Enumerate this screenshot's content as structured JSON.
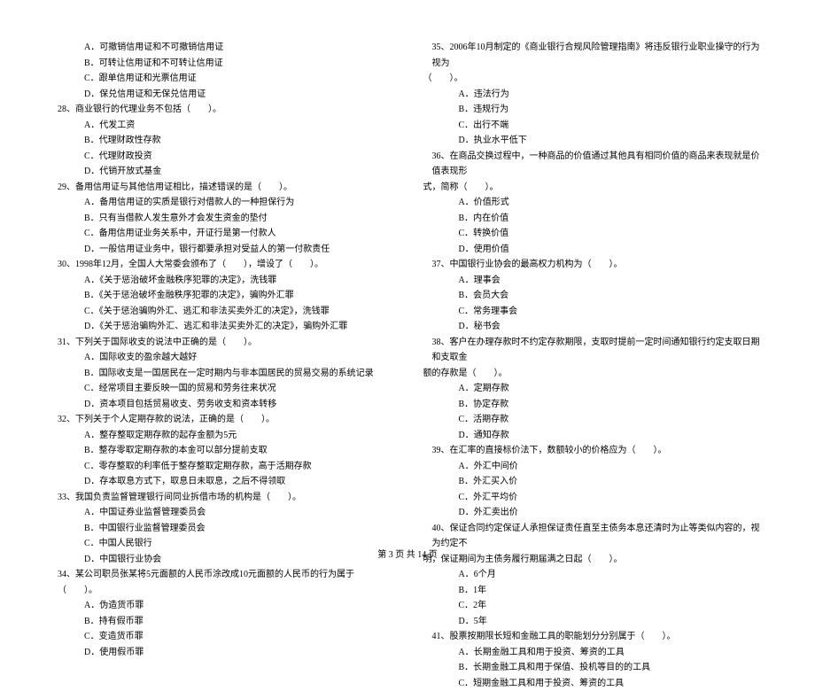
{
  "left": {
    "q27opts": [
      "A．可撤销信用证和不可撤销信用证",
      "B．可转让信用证和不可转让信用证",
      "C．跟单信用证和光票信用证",
      "D．保兑信用证和无保兑信用证"
    ],
    "q28": "28、商业银行的代理业务不包括（　　）。",
    "q28opts": [
      "A．代发工资",
      "B．代理财政性存款",
      "C．代理财政投资",
      "D．代销开放式基金"
    ],
    "q29": "29、备用信用证与其他信用证相比，描述错误的是（　　）。",
    "q29opts": [
      "A．备用信用证的实质是银行对借款人的一种担保行为",
      "B．只有当借款人发生意外才会发生资金的垫付",
      "C．备用信用证业务关系中，开证行是第一付款人",
      "D．一般信用证业务中，银行都要承担对受益人的第一付款责任"
    ],
    "q30": "30、1998年12月，全国人大常委会颁布了（　　），增设了（　　）。",
    "q30opts": [
      "A．《关于惩治破坏金融秩序犯罪的决定》，洗钱罪",
      "B．《关于惩治破坏金融秩序犯罪的决定》，骗购外汇罪",
      "C．《关于惩治骗购外汇、逃汇和非法买卖外汇的决定》，洗钱罪",
      "D．《关于惩治骗购外汇、逃汇和非法买卖外汇的决定》，骗购外汇罪"
    ],
    "q31": "31、下列关于国际收支的说法中正确的是（　　）。",
    "q31opts": [
      "A．国际收支的盈余越大越好",
      "B．国际收支是一国居民在一定时期内与非本国居民的贸易交易的系统记录",
      "C．经常项目主要反映一国的贸易和劳务往来状况",
      "D．资本项目包括贸易收支、劳务收支和资本转移"
    ],
    "q32": "32、下列关于个人定期存款的说法，正确的是（　　）。",
    "q32opts": [
      "A．整存整取定期存款的起存金额为5元",
      "B．整存零取定期存款的本金可以部分提前支取",
      "C．零存整取的利率低于整存整取定期存款，高于活期存款",
      "D．存本取息方式下，取息日未取息，之后不得领取"
    ],
    "q33": "33、我国负责监督管理银行间同业拆借市场的机构是（　　）。",
    "q33opts": [
      "A．中国证券业监督管理委员会",
      "B．中国银行业监督管理委员会",
      "C．中国人民银行",
      "D．中国银行业协会"
    ],
    "q34": "34、某公司职员张某将5元面额的人民币涂改成10元面额的人民币的行为属于（　　）。",
    "q34opts": [
      "A．伪造货币罪",
      "B．持有假币罪",
      "C．变造货币罪",
      "D．使用假币罪"
    ]
  },
  "right": {
    "q35": "35、2006年10月制定的《商业银行合规风险管理指南》将违反银行业职业操守的行为视为",
    "q35cont": "（　　）。",
    "q35opts": [
      "A．违法行为",
      "B．违规行为",
      "C．出行不端",
      "D．执业水平低下"
    ],
    "q36": "36、在商品交换过程中，一种商品的价值通过其他具有相同价值的商品来表现就是价值表现形",
    "q36cont": "式，简称（　　）。",
    "q36opts": [
      "A．价值形式",
      "B．内在价值",
      "C．转换价值",
      "D．使用价值"
    ],
    "q37": "37、中国银行业协会的最高权力机构为（　　）。",
    "q37opts": [
      "A．理事会",
      "B．会员大会",
      "C．常务理事会",
      "D．秘书会"
    ],
    "q38": "38、客户在办理存款时不约定存款期限，支取时提前一定时间通知银行约定支取日期和支取金",
    "q38cont": "额的存款是（　　）。",
    "q38opts": [
      "A．定期存款",
      "B．协定存款",
      "C．活期存款",
      "D．通知存款"
    ],
    "q39": "39、在汇率的直接标价法下，数额较小的价格应为（　　）。",
    "q39opts": [
      "A．外汇中间价",
      "B．外汇买入价",
      "C．外汇平均价",
      "D．外汇卖出价"
    ],
    "q40": "40、保证合同约定保证人承担保证责任直至主债务本息还清时为止等类似内容的，视为约定不",
    "q40cont": "明，保证期间为主债务履行期届满之日起（　　）。",
    "q40opts": [
      "A．6个月",
      "B．1年",
      "C．2年",
      "D．5年"
    ],
    "q41": "41、股票按期限长短和金融工具的职能划分分别属于（　　）。",
    "q41opts": [
      "A．长期金融工具和用于投资、筹资的工具",
      "B．长期金融工具和用于保值、投机等目的的工具",
      "C．短期金融工具和用于投资、筹资的工具"
    ]
  },
  "footer": "第 3 页 共 14 页"
}
